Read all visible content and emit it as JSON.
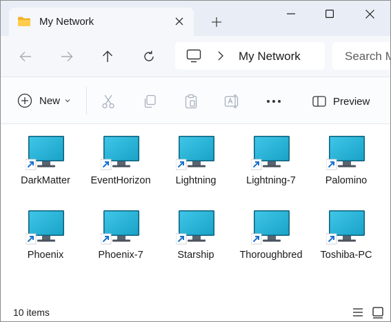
{
  "window": {
    "tab_title": "My Network",
    "tab_icon": "folder-icon"
  },
  "nav": {
    "breadcrumb_location": "My Network",
    "search_placeholder": "Search My Network"
  },
  "commands": {
    "new_label": "New",
    "preview_label": "Preview"
  },
  "items": [
    {
      "label": "DarkMatter"
    },
    {
      "label": "EventHorizon"
    },
    {
      "label": "Lightning"
    },
    {
      "label": "Lightning-7"
    },
    {
      "label": "Palomino"
    },
    {
      "label": "Phoenix"
    },
    {
      "label": "Phoenix-7"
    },
    {
      "label": "Starship"
    },
    {
      "label": "Thoroughbred"
    },
    {
      "label": "Toshiba-PC"
    }
  ],
  "status": {
    "item_count": "10 items"
  },
  "colors": {
    "titlebar_bg": "#e9eef6",
    "monitor_screen": "#1aa3c8",
    "shortcut_arrow": "#1a6fd1"
  }
}
